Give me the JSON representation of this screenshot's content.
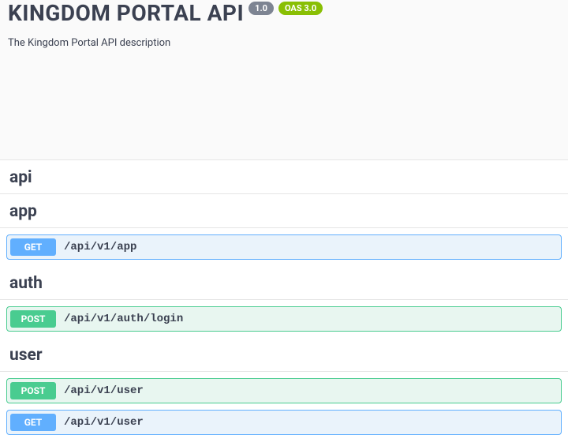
{
  "header": {
    "title": "KINGDOM PORTAL API",
    "version_badge": "1.0",
    "oas_badge": "OAS 3.0",
    "description": "The Kingdom Portal API description"
  },
  "tags": [
    {
      "name": "api",
      "ops": []
    },
    {
      "name": "app",
      "ops": [
        {
          "method": "GET",
          "path": "/api/v1/app"
        }
      ]
    },
    {
      "name": "auth",
      "ops": [
        {
          "method": "POST",
          "path": "/api/v1/auth/login"
        }
      ]
    },
    {
      "name": "user",
      "ops": [
        {
          "method": "POST",
          "path": "/api/v1/user"
        },
        {
          "method": "GET",
          "path": "/api/v1/user"
        }
      ]
    }
  ]
}
